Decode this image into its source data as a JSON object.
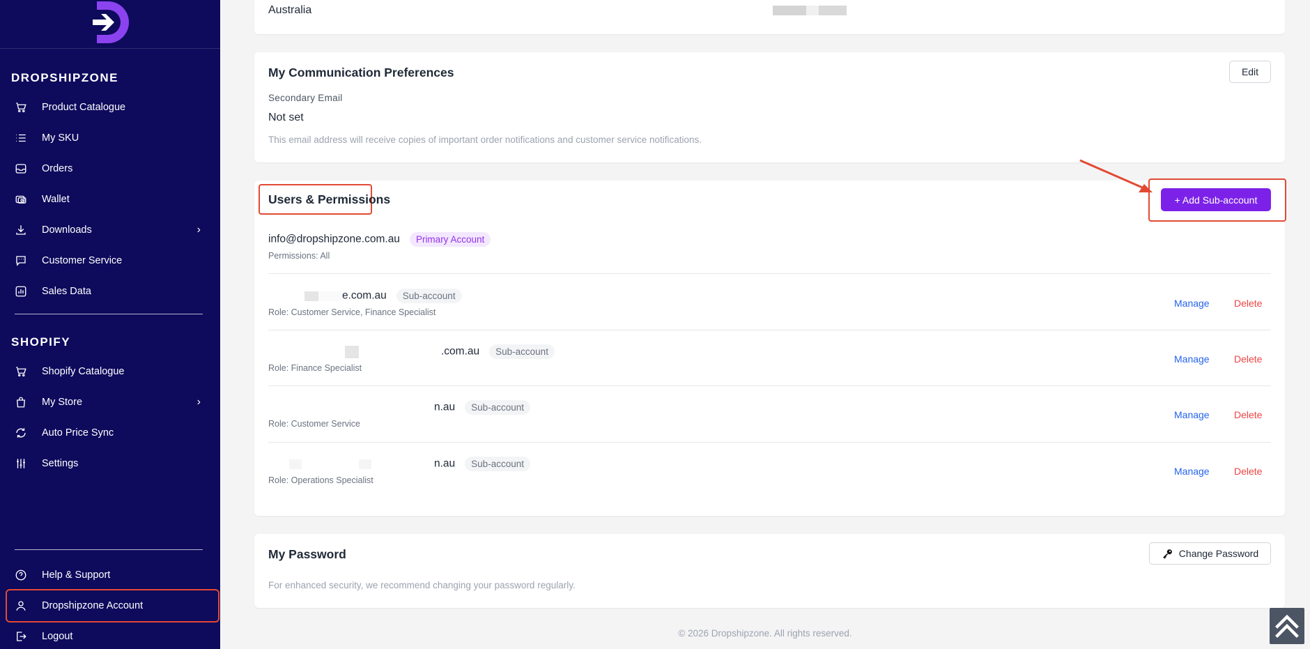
{
  "brand": {
    "logo_icon": "dropshipzone-logo-icon",
    "accent": "#7c22e8",
    "sidebar_bg": "#0e0a5c"
  },
  "sidebar": {
    "section_dropshipzone": "DROPSHIPZONE",
    "dropshipzone_items": [
      {
        "label": "Product Catalogue",
        "icon": "cart-icon"
      },
      {
        "label": "My SKU",
        "icon": "list-icon"
      },
      {
        "label": "Orders",
        "icon": "inbox-icon"
      },
      {
        "label": "Wallet",
        "icon": "wallet-icon"
      },
      {
        "label": "Downloads",
        "icon": "download-icon"
      },
      {
        "label": "Customer Service",
        "icon": "chat-icon"
      },
      {
        "label": "Sales Data",
        "icon": "chart-icon"
      }
    ],
    "section_shopify": "SHOPIFY",
    "shopify_items": [
      {
        "label": "Shopify Catalogue",
        "icon": "cart-icon"
      },
      {
        "label": "My Store",
        "icon": "bag-icon"
      },
      {
        "label": "Auto Price Sync",
        "icon": "sync-icon"
      },
      {
        "label": "Settings",
        "icon": "sliders-icon"
      }
    ],
    "bottom_items": [
      {
        "label": "Help & Support",
        "icon": "help-icon"
      },
      {
        "label": "Dropshipzone Account",
        "icon": "user-icon"
      },
      {
        "label": "Logout",
        "icon": "logout-icon"
      }
    ]
  },
  "address": {
    "country": "Australia"
  },
  "communication": {
    "title": "My Communication Preferences",
    "edit_label": "Edit",
    "secondary_email_label": "Secondary Email",
    "secondary_email_value": "Not set",
    "help_text": "This email address will receive copies of important order notifications and customer service notifications."
  },
  "users": {
    "title": "Users & Permissions",
    "add_button": "+ Add Sub-account",
    "primary": {
      "email": "info@dropshipzone.com.au",
      "badge": "Primary Account",
      "permissions": "Permissions: All"
    },
    "subaccounts": [
      {
        "email_tail": "e.com.au",
        "badge": "Sub-account",
        "role": "Role: Customer Service, Finance Specialist",
        "manage": "Manage",
        "delete": "Delete"
      },
      {
        "email_tail": ".com.au",
        "badge": "Sub-account",
        "role": "Role: Finance Specialist",
        "manage": "Manage",
        "delete": "Delete"
      },
      {
        "email_tail": "n.au",
        "badge": "Sub-account",
        "role": "Role: Customer Service",
        "manage": "Manage",
        "delete": "Delete"
      },
      {
        "email_tail": "n.au",
        "badge": "Sub-account",
        "role": "Role: Operations Specialist",
        "manage": "Manage",
        "delete": "Delete"
      }
    ]
  },
  "password": {
    "title": "My Password",
    "change_button": "Change Password",
    "help_text": "For enhanced security, we recommend changing your password regularly."
  },
  "footer": {
    "copyright": "© 2026 Dropshipzone. All rights reserved."
  }
}
